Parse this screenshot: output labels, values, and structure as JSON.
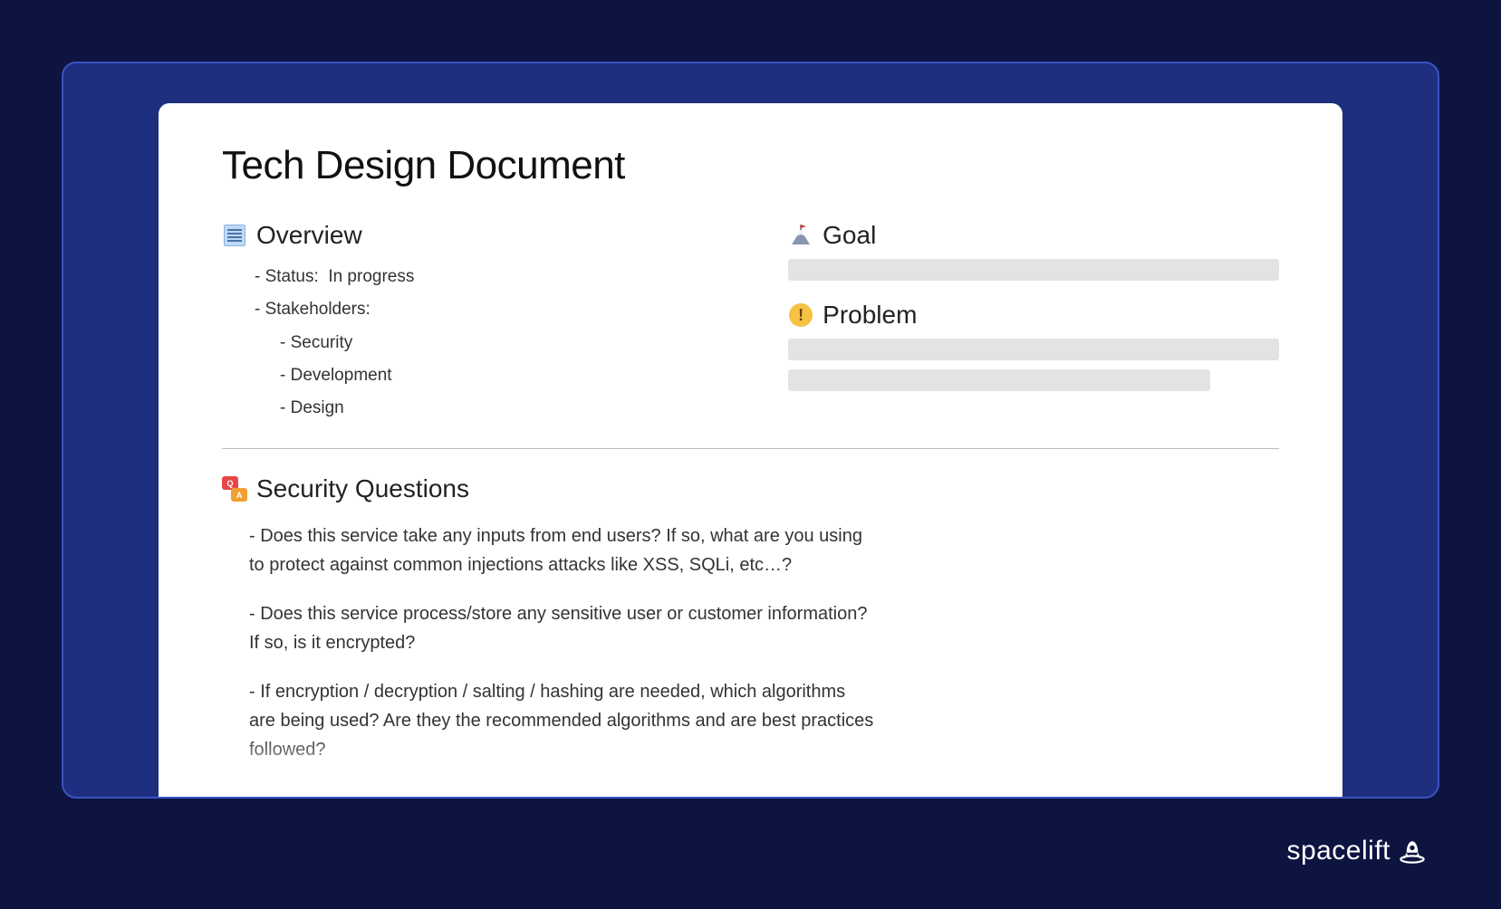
{
  "brand": "spacelift",
  "document": {
    "title": "Tech Design Document",
    "overview": {
      "heading": "Overview",
      "status_label": "- Status:",
      "status_value": "In progress",
      "stakeholders_label": "- Stakeholders:",
      "stakeholders": [
        "- Security",
        "- Development",
        "- Design"
      ]
    },
    "goal": {
      "heading": "Goal"
    },
    "problem": {
      "heading": "Problem"
    },
    "security_questions": {
      "heading": "Security Questions",
      "items": [
        "- Does this service take any inputs from end users? If so, what are you using to protect against common injections attacks like XSS, SQLi, etc…?",
        "- Does this service process/store any sensitive user or customer information? If so, is it encrypted?",
        "- If encryption / decryption / salting / hashing are needed, which algorithms are being used? Are they the recommended algorithms and are best practices followed?"
      ]
    }
  }
}
